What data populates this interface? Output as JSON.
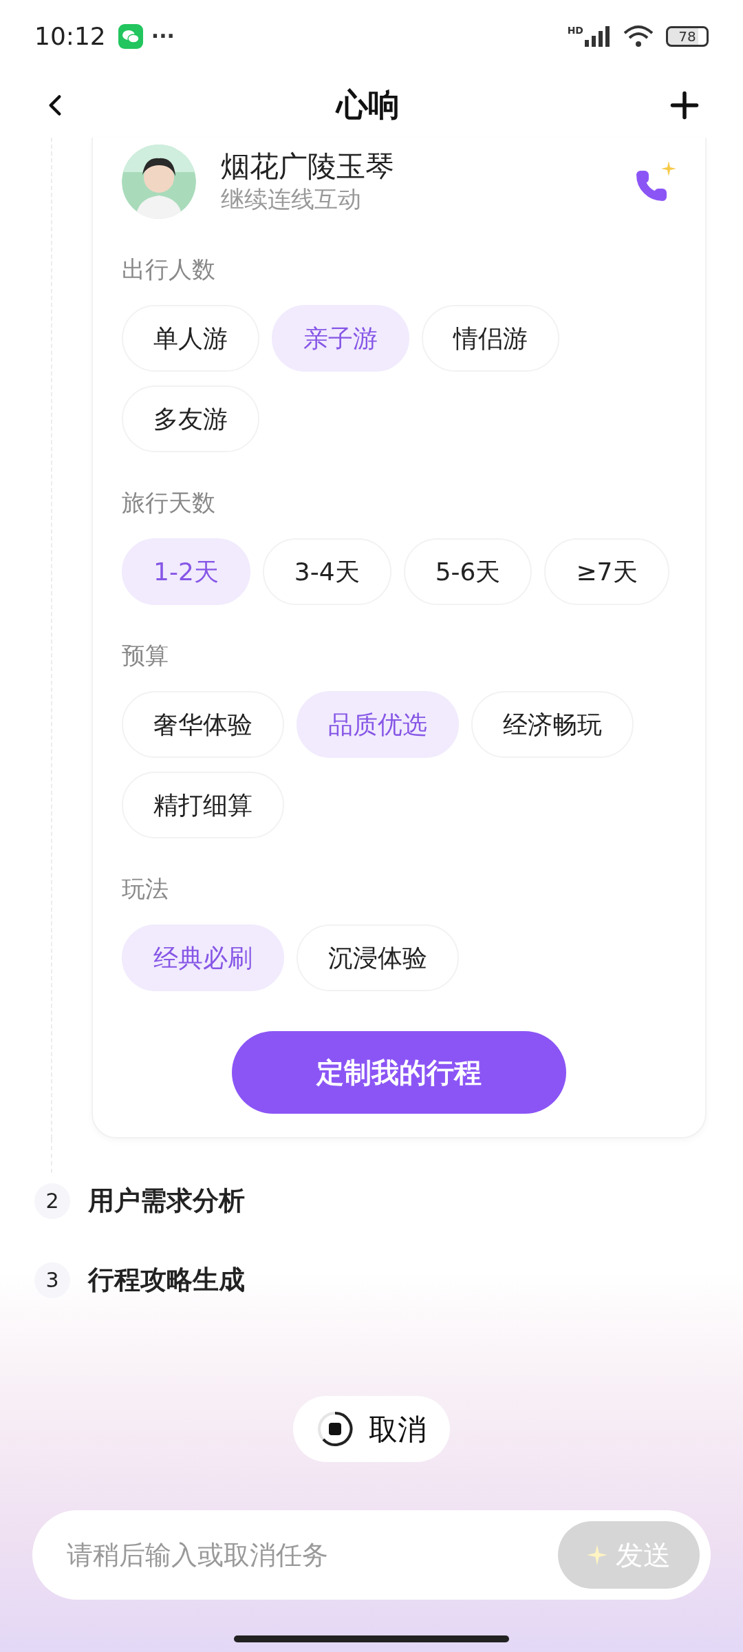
{
  "status_bar": {
    "time": "10:12",
    "more": "···",
    "network": "HD",
    "battery": "78"
  },
  "header": {
    "title": "心响"
  },
  "agent": {
    "name": "烟花广陵玉琴",
    "subtitle": "继续连线互动"
  },
  "groups": [
    {
      "label": "出行人数",
      "options": [
        {
          "label": "单人游",
          "selected": false
        },
        {
          "label": "亲子游",
          "selected": true
        },
        {
          "label": "情侣游",
          "selected": false
        },
        {
          "label": "多友游",
          "selected": false
        }
      ]
    },
    {
      "label": "旅行天数",
      "options": [
        {
          "label": "1-2天",
          "selected": true
        },
        {
          "label": "3-4天",
          "selected": false
        },
        {
          "label": "5-6天",
          "selected": false
        },
        {
          "label": "≥7天",
          "selected": false
        }
      ]
    },
    {
      "label": "预算",
      "options": [
        {
          "label": "奢华体验",
          "selected": false
        },
        {
          "label": "品质优选",
          "selected": true
        },
        {
          "label": "经济畅玩",
          "selected": false
        },
        {
          "label": "精打细算",
          "selected": false
        }
      ]
    },
    {
      "label": "玩法",
      "options": [
        {
          "label": "经典必刷",
          "selected": true
        },
        {
          "label": "沉浸体验",
          "selected": false
        }
      ]
    }
  ],
  "submit": "定制我的行程",
  "steps": [
    {
      "number": "2",
      "label": "用户需求分析"
    },
    {
      "number": "3",
      "label": "行程攻略生成"
    }
  ],
  "cancel": "取消",
  "input": {
    "placeholder": "请稍后输入或取消任务",
    "send": "发送",
    "send_disabled": true
  }
}
